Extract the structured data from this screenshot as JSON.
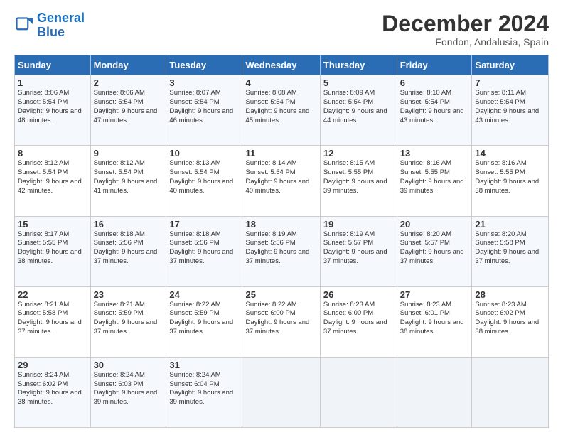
{
  "header": {
    "logo_line1": "General",
    "logo_line2": "Blue",
    "main_title": "December 2024",
    "subtitle": "Fondon, Andalusia, Spain"
  },
  "calendar": {
    "days_of_week": [
      "Sunday",
      "Monday",
      "Tuesday",
      "Wednesday",
      "Thursday",
      "Friday",
      "Saturday"
    ],
    "weeks": [
      [
        {
          "day": "1",
          "sunrise": "8:06 AM",
          "sunset": "5:54 PM",
          "daylight": "9 hours and 48 minutes."
        },
        {
          "day": "2",
          "sunrise": "8:06 AM",
          "sunset": "5:54 PM",
          "daylight": "9 hours and 47 minutes."
        },
        {
          "day": "3",
          "sunrise": "8:07 AM",
          "sunset": "5:54 PM",
          "daylight": "9 hours and 46 minutes."
        },
        {
          "day": "4",
          "sunrise": "8:08 AM",
          "sunset": "5:54 PM",
          "daylight": "9 hours and 45 minutes."
        },
        {
          "day": "5",
          "sunrise": "8:09 AM",
          "sunset": "5:54 PM",
          "daylight": "9 hours and 44 minutes."
        },
        {
          "day": "6",
          "sunrise": "8:10 AM",
          "sunset": "5:54 PM",
          "daylight": "9 hours and 43 minutes."
        },
        {
          "day": "7",
          "sunrise": "8:11 AM",
          "sunset": "5:54 PM",
          "daylight": "9 hours and 43 minutes."
        }
      ],
      [
        {
          "day": "8",
          "sunrise": "8:12 AM",
          "sunset": "5:54 PM",
          "daylight": "9 hours and 42 minutes."
        },
        {
          "day": "9",
          "sunrise": "8:12 AM",
          "sunset": "5:54 PM",
          "daylight": "9 hours and 41 minutes."
        },
        {
          "day": "10",
          "sunrise": "8:13 AM",
          "sunset": "5:54 PM",
          "daylight": "9 hours and 40 minutes."
        },
        {
          "day": "11",
          "sunrise": "8:14 AM",
          "sunset": "5:54 PM",
          "daylight": "9 hours and 40 minutes."
        },
        {
          "day": "12",
          "sunrise": "8:15 AM",
          "sunset": "5:55 PM",
          "daylight": "9 hours and 39 minutes."
        },
        {
          "day": "13",
          "sunrise": "8:16 AM",
          "sunset": "5:55 PM",
          "daylight": "9 hours and 39 minutes."
        },
        {
          "day": "14",
          "sunrise": "8:16 AM",
          "sunset": "5:55 PM",
          "daylight": "9 hours and 38 minutes."
        }
      ],
      [
        {
          "day": "15",
          "sunrise": "8:17 AM",
          "sunset": "5:55 PM",
          "daylight": "9 hours and 38 minutes."
        },
        {
          "day": "16",
          "sunrise": "8:18 AM",
          "sunset": "5:56 PM",
          "daylight": "9 hours and 37 minutes."
        },
        {
          "day": "17",
          "sunrise": "8:18 AM",
          "sunset": "5:56 PM",
          "daylight": "9 hours and 37 minutes."
        },
        {
          "day": "18",
          "sunrise": "8:19 AM",
          "sunset": "5:56 PM",
          "daylight": "9 hours and 37 minutes."
        },
        {
          "day": "19",
          "sunrise": "8:19 AM",
          "sunset": "5:57 PM",
          "daylight": "9 hours and 37 minutes."
        },
        {
          "day": "20",
          "sunrise": "8:20 AM",
          "sunset": "5:57 PM",
          "daylight": "9 hours and 37 minutes."
        },
        {
          "day": "21",
          "sunrise": "8:20 AM",
          "sunset": "5:58 PM",
          "daylight": "9 hours and 37 minutes."
        }
      ],
      [
        {
          "day": "22",
          "sunrise": "8:21 AM",
          "sunset": "5:58 PM",
          "daylight": "9 hours and 37 minutes."
        },
        {
          "day": "23",
          "sunrise": "8:21 AM",
          "sunset": "5:59 PM",
          "daylight": "9 hours and 37 minutes."
        },
        {
          "day": "24",
          "sunrise": "8:22 AM",
          "sunset": "5:59 PM",
          "daylight": "9 hours and 37 minutes."
        },
        {
          "day": "25",
          "sunrise": "8:22 AM",
          "sunset": "6:00 PM",
          "daylight": "9 hours and 37 minutes."
        },
        {
          "day": "26",
          "sunrise": "8:23 AM",
          "sunset": "6:00 PM",
          "daylight": "9 hours and 37 minutes."
        },
        {
          "day": "27",
          "sunrise": "8:23 AM",
          "sunset": "6:01 PM",
          "daylight": "9 hours and 38 minutes."
        },
        {
          "day": "28",
          "sunrise": "8:23 AM",
          "sunset": "6:02 PM",
          "daylight": "9 hours and 38 minutes."
        }
      ],
      [
        {
          "day": "29",
          "sunrise": "8:24 AM",
          "sunset": "6:02 PM",
          "daylight": "9 hours and 38 minutes."
        },
        {
          "day": "30",
          "sunrise": "8:24 AM",
          "sunset": "6:03 PM",
          "daylight": "9 hours and 39 minutes."
        },
        {
          "day": "31",
          "sunrise": "8:24 AM",
          "sunset": "6:04 PM",
          "daylight": "9 hours and 39 minutes."
        },
        null,
        null,
        null,
        null
      ]
    ]
  }
}
